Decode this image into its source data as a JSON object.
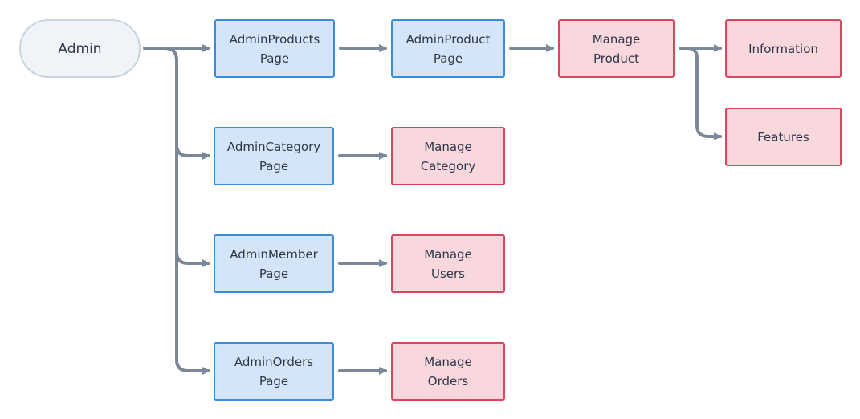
{
  "colors": {
    "admin_fill": "#f0f4f8",
    "admin_border": "#c9d3dd",
    "page_fill": "#d4e5f7",
    "page_border": "#3b8ddb",
    "manage_fill": "#f8d7dd",
    "manage_border": "#d9475f",
    "edge": "#7a8898"
  },
  "nodes": {
    "admin": "Admin",
    "admin_products_page": "AdminProducts\nPage",
    "admin_product_page": "AdminProduct\nPage",
    "manage_product": "Manage\nProduct",
    "information": "Information",
    "features": "Features",
    "admin_category_page": "AdminCategory\nPage",
    "manage_category": "Manage\nCategory",
    "admin_member_page": "AdminMember\nPage",
    "manage_users": "Manage\nUsers",
    "admin_orders_page": "AdminOrders\nPage",
    "manage_orders": "Manage\nOrders"
  },
  "edges": [
    [
      "admin",
      "admin_products_page"
    ],
    [
      "admin",
      "admin_category_page"
    ],
    [
      "admin",
      "admin_member_page"
    ],
    [
      "admin",
      "admin_orders_page"
    ],
    [
      "admin_products_page",
      "admin_product_page"
    ],
    [
      "admin_product_page",
      "manage_product"
    ],
    [
      "manage_product",
      "information"
    ],
    [
      "manage_product",
      "features"
    ],
    [
      "admin_category_page",
      "manage_category"
    ],
    [
      "admin_member_page",
      "manage_users"
    ],
    [
      "admin_orders_page",
      "manage_orders"
    ]
  ]
}
